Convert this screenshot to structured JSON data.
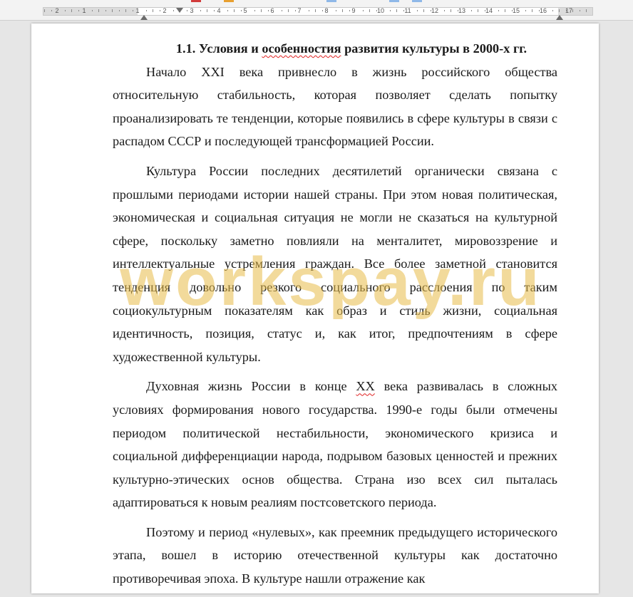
{
  "ruler": {
    "numbers": [
      "2",
      "1",
      "1",
      "2",
      "3",
      "4",
      "5",
      "6",
      "7",
      "8",
      "9",
      "10",
      "11",
      "12",
      "13",
      "14",
      "15",
      "16",
      "17"
    ]
  },
  "document": {
    "heading": {
      "before": "1.1. Условия и ",
      "misspelled": "особенностия",
      "after": " развития культуры в 2000-х гг."
    },
    "paragraphs": [
      {
        "text": "Начало XXI века привнесло в жизнь российского общества относительную стабильность, которая позволяет сделать попытку проанализировать те тенденции, которые появились в сфере культуры в связи с распадом СССР и последующей трансформацией России."
      },
      {
        "text": "Культура России последних десятилетий органически связана с прошлыми периодами истории нашей страны. При этом новая политическая, экономическая и социальная ситуация не могли не сказаться на культурной сфере, поскольку заметно повлияли на менталитет, мировоззрение и интеллектуальные устремления граждан. Все более заметной становится тенденция довольно резкого социального расслоения по таким социокультурным показателям как образ и стиль жизни, социальная идентичность, позиция, статус и, как итог, предпочтениям в сфере художественной культуры."
      },
      {
        "before": "Духовная жизнь России в конце ",
        "misspelled": "ХХ",
        "after": " века развивалась в сложных условиях формирования нового государства. 1990-е годы были отмечены периодом политической нестабильности, экономического кризиса и социальной дифференциации народа, подрывом базовых ценностей и прежних культурно-этических основ общества. Страна изо всех сил пыталась адаптироваться к новым реалиям постсоветского периода."
      },
      {
        "text": "Поэтому и период «нулевых», как преемник предыдущего исторического этапа, вошел в историю отечественной культуры как достаточно противоречивая эпоха. В культуре нашли отражение как"
      }
    ]
  },
  "watermark": {
    "text": "workspay.ru"
  },
  "colors": {
    "page": "#ffffff",
    "background": "#e6e6e6",
    "spellcheck": "#e02020",
    "watermark": "#e8bc48"
  }
}
